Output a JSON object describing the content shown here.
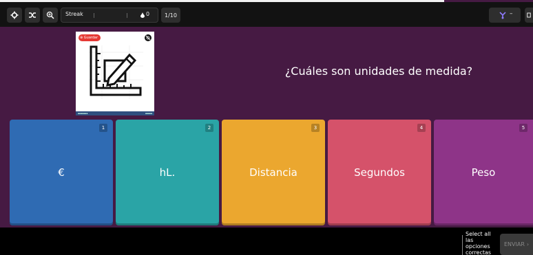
{
  "toolbar": {
    "settings_icon": "gear-icon",
    "shuffle_icon": "shuffle-icon",
    "zoom_icon": "zoom-in-icon",
    "streak_label": "Streak",
    "streak_count": "0",
    "question_counter": "1/10",
    "powerup_dash": "–"
  },
  "question": {
    "save_badge": "Guardar",
    "text": "¿Cuáles son unidades de medida?"
  },
  "answers": [
    {
      "number": "1",
      "text": "€",
      "color": "#2f6bb3"
    },
    {
      "number": "2",
      "text": "hL.",
      "color": "#2aa4a6"
    },
    {
      "number": "3",
      "text": "Distancia",
      "color": "#eba72f"
    },
    {
      "number": "4",
      "text": "Segundos",
      "color": "#d5526a"
    },
    {
      "number": "5",
      "text": "Peso",
      "color": "#8e3488"
    }
  ],
  "footer": {
    "hint": "Select all las opciones correctas",
    "submit_label": "ENVIAR"
  }
}
